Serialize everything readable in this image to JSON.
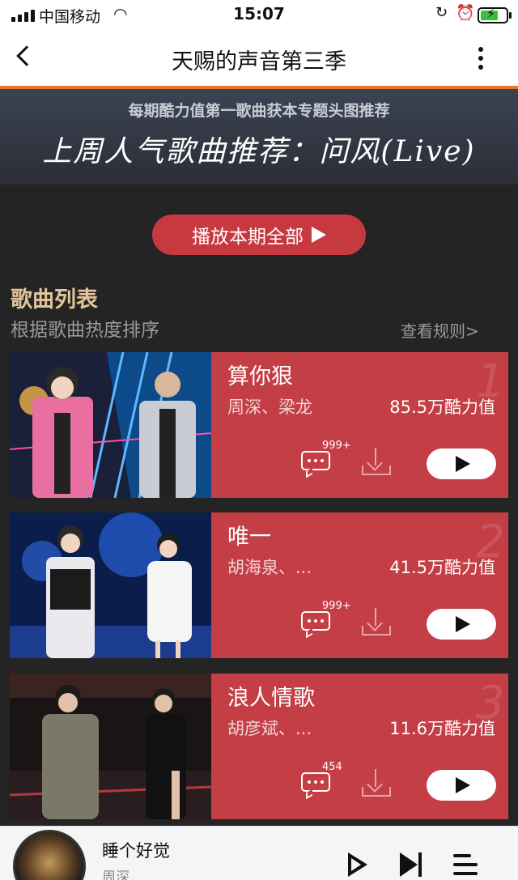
{
  "status_bar": {
    "carrier": "中国移动",
    "time": "15:07",
    "battery_percent": 70,
    "battery_color": "#3cbf3c"
  },
  "nav": {
    "title": "天赐的声音第三季",
    "back_icon": "chevron-left-icon",
    "more_icon": "more-vertical-icon"
  },
  "banner": {
    "subtitle": "每期酷力值第一歌曲获本专题头图推荐",
    "headline": "上周人气歌曲推荐：问风(Live)"
  },
  "play_all_label": "播放本期全部",
  "list": {
    "title": "歌曲列表",
    "subtitle": "根据歌曲热度排序",
    "rules_link": "查看规则>"
  },
  "songs": [
    {
      "rank": "1",
      "title": "算你狠",
      "artists": "周深、梁龙",
      "score": "85.5万酷力值",
      "comments": "999+"
    },
    {
      "rank": "2",
      "title": "唯一",
      "artists": "胡海泉、...",
      "score": "41.5万酷力值",
      "comments": "999+"
    },
    {
      "rank": "3",
      "title": "浪人情歌",
      "artists": "胡彦斌、...",
      "score": "11.6万酷力值",
      "comments": "454"
    }
  ],
  "mini_player": {
    "song": "睡个好觉",
    "artist": "周深"
  },
  "colors": {
    "accent": "#c6393f",
    "card_bg": "#c43e46",
    "gold_text": "#e3c49a",
    "orange_line": "#e8742e"
  }
}
